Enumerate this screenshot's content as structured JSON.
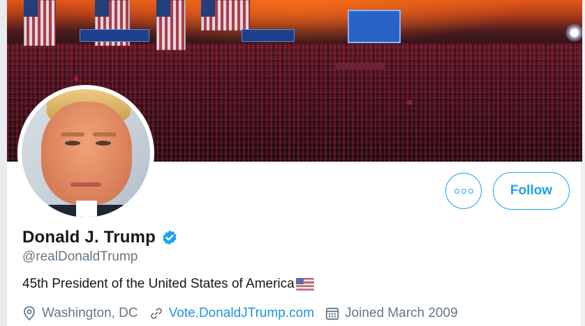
{
  "profile": {
    "name": "Donald J. Trump",
    "handle": "@realDonaldTrump",
    "bio": "45th President of the United States of America",
    "bio_emoji": "us-flag-icon",
    "location": "Washington, DC",
    "website": "Vote.DonaldJTrump.com",
    "joined": "Joined March 2009",
    "verified": true
  },
  "actions": {
    "more_icon": "more-horizontal-icon",
    "follow_label": "Follow"
  },
  "colors": {
    "accent": "#1da1f2",
    "link": "#1b95e0",
    "text_primary": "#14171a",
    "text_secondary": "#657786"
  },
  "icons": {
    "location": "location-pin-icon",
    "website": "link-icon",
    "joined": "calendar-icon",
    "verified": "verified-badge-icon"
  }
}
